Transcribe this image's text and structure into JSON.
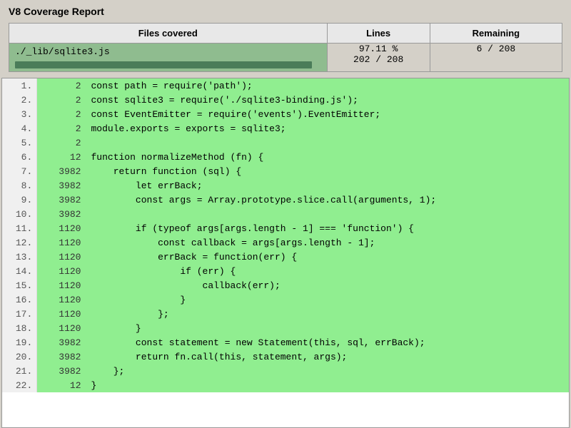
{
  "title": "V8 Coverage Report",
  "table": {
    "headers": [
      "Files covered",
      "Lines",
      "Remaining"
    ],
    "rows": [
      {
        "file": "./_lib/sqlite3.js",
        "coverage_pct": "97.11 %",
        "lines": "202 / 208",
        "remaining": "6 / 208",
        "bar_width": "97"
      }
    ]
  },
  "code_lines": [
    {
      "num": "1.",
      "hits": "2",
      "code": "const path = require('path');",
      "covered": true
    },
    {
      "num": "2.",
      "hits": "2",
      "code": "const sqlite3 = require('./sqlite3-binding.js');",
      "covered": true
    },
    {
      "num": "3.",
      "hits": "2",
      "code": "const EventEmitter = require('events').EventEmitter;",
      "covered": true
    },
    {
      "num": "4.",
      "hits": "2",
      "code": "module.exports = exports = sqlite3;",
      "covered": true
    },
    {
      "num": "5.",
      "hits": "2",
      "code": "",
      "covered": true
    },
    {
      "num": "6.",
      "hits": "12",
      "code": "function normalizeMethod (fn) {",
      "covered": true
    },
    {
      "num": "7.",
      "hits": "3982",
      "code": "    return function (sql) {",
      "covered": true
    },
    {
      "num": "8.",
      "hits": "3982",
      "code": "        let errBack;",
      "covered": true
    },
    {
      "num": "9.",
      "hits": "3982",
      "code": "        const args = Array.prototype.slice.call(arguments, 1);",
      "covered": true
    },
    {
      "num": "10.",
      "hits": "3982",
      "code": "",
      "covered": true
    },
    {
      "num": "11.",
      "hits": "1120",
      "code": "        if (typeof args[args.length - 1] === 'function') {",
      "covered": true
    },
    {
      "num": "12.",
      "hits": "1120",
      "code": "            const callback = args[args.length - 1];",
      "covered": true
    },
    {
      "num": "13.",
      "hits": "1120",
      "code": "            errBack = function(err) {",
      "covered": true
    },
    {
      "num": "14.",
      "hits": "1120",
      "code": "                if (err) {",
      "covered": true
    },
    {
      "num": "15.",
      "hits": "1120",
      "code": "                    callback(err);",
      "covered": true
    },
    {
      "num": "16.",
      "hits": "1120",
      "code": "                }",
      "covered": true
    },
    {
      "num": "17.",
      "hits": "1120",
      "code": "            };",
      "covered": true
    },
    {
      "num": "18.",
      "hits": "1120",
      "code": "        }",
      "covered": true
    },
    {
      "num": "19.",
      "hits": "3982",
      "code": "        const statement = new Statement(this, sql, errBack);",
      "covered": true
    },
    {
      "num": "20.",
      "hits": "3982",
      "code": "        return fn.call(this, statement, args);",
      "covered": true
    },
    {
      "num": "21.",
      "hits": "3982",
      "code": "    };",
      "covered": true
    },
    {
      "num": "22.",
      "hits": "12",
      "code": "}",
      "covered": true
    }
  ]
}
